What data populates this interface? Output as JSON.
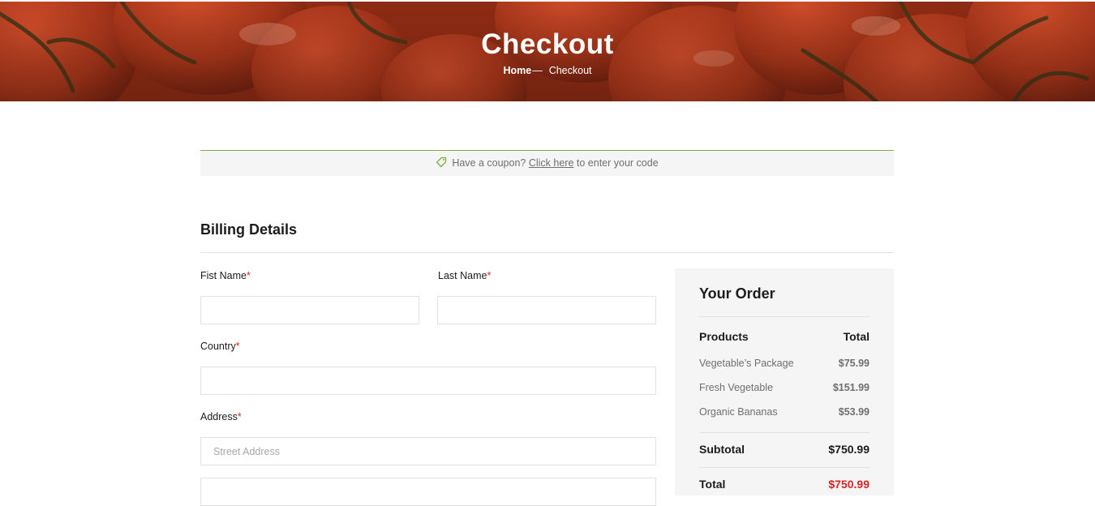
{
  "hero": {
    "title": "Checkout",
    "breadcrumb": {
      "home": "Home",
      "separator": "—",
      "current": "Checkout"
    }
  },
  "coupon": {
    "icon": "tag-icon",
    "prefix": "Have a coupon?",
    "link": "Click here",
    "suffix": "to enter your code"
  },
  "billing": {
    "title": "Billing Details",
    "required_marker": "*",
    "first_name": {
      "label": "Fist Name",
      "value": ""
    },
    "last_name": {
      "label": "Last Name",
      "value": ""
    },
    "country": {
      "label": "Country",
      "value": ""
    },
    "address": {
      "label": "Address",
      "placeholder": "Street Address",
      "value": ""
    }
  },
  "order": {
    "title": "Your Order",
    "header": {
      "products": "Products",
      "total": "Total"
    },
    "items": [
      {
        "name": "Vegetable’s Package",
        "price": "$75.99"
      },
      {
        "name": "Fresh Vegetable",
        "price": "$151.99"
      },
      {
        "name": "Organic Bananas",
        "price": "$53.99"
      }
    ],
    "subtotal": {
      "label": "Subtotal",
      "value": "$750.99"
    },
    "total": {
      "label": "Total",
      "value": "$750.99"
    }
  },
  "colors": {
    "accent_green": "#7fad39",
    "required_red": "#dd2222",
    "hero_bg": "#a8361c",
    "panel_bg": "#f5f5f5"
  }
}
